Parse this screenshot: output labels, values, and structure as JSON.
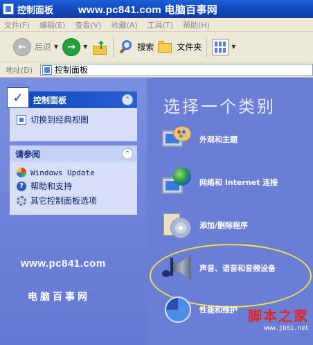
{
  "window": {
    "title": "控制面板",
    "watermark": "www.pc841.com 电脑百事网"
  },
  "menu": [
    "文件(F)",
    "编辑(E)",
    "查看(V)",
    "收藏(A)",
    "工具(T)",
    "帮助(H)"
  ],
  "toolbar": {
    "back_label": "后退",
    "search_label": "搜索",
    "folders_label": "文件夹"
  },
  "address": {
    "label": "地址(D)",
    "value": "控制面板"
  },
  "sidebar": {
    "control_panel": {
      "title": "控制面板",
      "switch_link": "切换到经典视图"
    },
    "see_also": {
      "title": "请参阅",
      "links": [
        "Windows Update",
        "帮助和支持",
        "其它控制面板选项"
      ]
    },
    "brand_url": "www.pc841.com",
    "brand_name": "电脑百事网"
  },
  "main": {
    "heading": "选择一个类别",
    "categories": [
      {
        "label": "外观和主题",
        "icon": "appearance-themes-icon"
      },
      {
        "label": "网络和 Internet 连接",
        "icon": "network-icon"
      },
      {
        "label": "添加/删除程序",
        "icon": "add-remove-programs-icon"
      },
      {
        "label": "声音、语音和音频设备",
        "icon": "sounds-audio-icon",
        "highlighted": true
      },
      {
        "label": "性能和维护",
        "icon": "performance-icon"
      }
    ]
  },
  "watermark_corner": {
    "name": "脚本之家",
    "url": "www.jb51.net"
  },
  "colors": {
    "titlebar": "#1146b8",
    "pane_background": "#6b7fd6",
    "highlight_ellipse": "#f3e14a"
  }
}
